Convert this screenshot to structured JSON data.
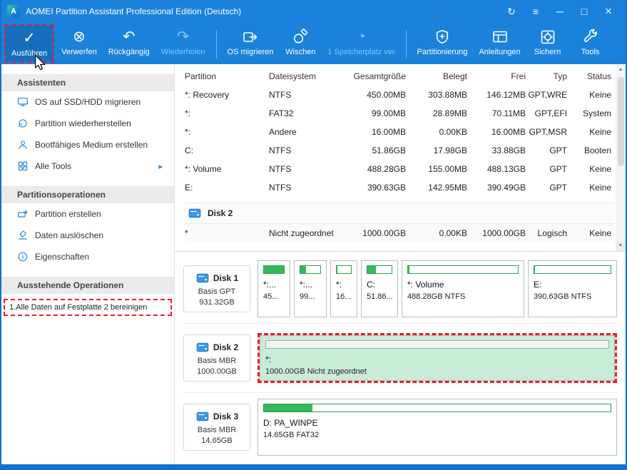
{
  "titlebar": {
    "title": "AOMEI Partition Assistant Professional Edition (Deutsch)",
    "logo_letter": "A",
    "controls": {
      "refresh": "↻",
      "menu": "≡",
      "minimize": "─",
      "maximize": "□",
      "close": "×"
    }
  },
  "toolbar": {
    "glyphs": {
      "check": "✓",
      "discard": "⊗",
      "undo": "↶",
      "redo": "↷",
      "space": "◔"
    },
    "buttons": [
      {
        "label": "Ausführen",
        "icon": "check-icon"
      },
      {
        "label": "Verwerfen",
        "icon": "discard-icon"
      },
      {
        "label": "Rückgängig",
        "icon": "undo-icon"
      },
      {
        "label": "Wiederholen",
        "icon": "redo-icon"
      },
      {
        "label": "OS migrieren",
        "icon": "migrate-icon"
      },
      {
        "label": "Wischen",
        "icon": "wipe-icon"
      },
      {
        "label": "1 Speicherplatz ver",
        "icon": "space-analyzer-icon"
      },
      {
        "label": "Partitionierung",
        "icon": "shield-plus-icon"
      },
      {
        "label": "Anleitungen",
        "icon": "guide-icon"
      },
      {
        "label": "Sichern",
        "icon": "safe-icon"
      },
      {
        "label": "Tools",
        "icon": "wrench-icon"
      }
    ]
  },
  "sidebar": {
    "chevron": "▸",
    "sections": [
      {
        "header": "Assistenten",
        "items": [
          {
            "label": "OS auf SSD/HDD migrieren",
            "icon": "monitor-icon"
          },
          {
            "label": "Partition wiederherstellen",
            "icon": "restore-icon"
          },
          {
            "label": "Bootfähiges Medium erstellen",
            "icon": "boot-medium-icon"
          },
          {
            "label": "Alle Tools",
            "icon": "grid-icon"
          }
        ]
      },
      {
        "header": "Partitionsoperationen",
        "items": [
          {
            "label": "Partition erstellen",
            "icon": "create-partition-icon"
          },
          {
            "label": "Daten auslöschen",
            "icon": "erase-icon"
          },
          {
            "label": "Eigenschaften",
            "icon": "info-icon"
          }
        ]
      },
      {
        "header": "Ausstehende Operationen",
        "items": [
          {
            "label": "1.Alle Daten auf Festplatte 2 bereinigen"
          }
        ]
      }
    ]
  },
  "table": {
    "columns": [
      "Partition",
      "Dateisystem",
      "Gesamtgröße",
      "Belegt",
      "Frei",
      "Typ",
      "Status"
    ],
    "rows": [
      {
        "partition": "*: Recovery",
        "fs": "NTFS",
        "total": "450.00MB",
        "used": "303.88MB",
        "free": "146.12MB",
        "typ": "GPT,WRE",
        "status": "Keine"
      },
      {
        "partition": "*:",
        "fs": "FAT32",
        "total": "99.00MB",
        "used": "28.89MB",
        "free": "70.11MB",
        "typ": "GPT,EFI",
        "status": "System"
      },
      {
        "partition": "*:",
        "fs": "Andere",
        "total": "16.00MB",
        "used": "0.00KB",
        "free": "16.00MB",
        "typ": "GPT,MSR",
        "status": "Keine"
      },
      {
        "partition": "C:",
        "fs": "NTFS",
        "total": "51.86GB",
        "used": "17.98GB",
        "free": "33.88GB",
        "typ": "GPT",
        "status": "Booten"
      },
      {
        "partition": "*: Volume",
        "fs": "NTFS",
        "total": "488.28GB",
        "used": "155.00MB",
        "free": "488.13GB",
        "typ": "GPT",
        "status": "Keine"
      },
      {
        "partition": "E:",
        "fs": "NTFS",
        "total": "390.63GB",
        "used": "142.95MB",
        "free": "390.49GB",
        "typ": "GPT",
        "status": "Keine"
      }
    ],
    "group_label": "Disk 2",
    "unallocated_row": {
      "partition": "*",
      "fs": "Nicht zugeordnet",
      "total": "1000.00GB",
      "used": "0.00KB",
      "free": "1000.00GB",
      "typ": "Logisch",
      "status": "Keine"
    },
    "scrollbar": {
      "up": "▲",
      "down": "▼"
    }
  },
  "disks": [
    {
      "name": "Disk 1",
      "type": "Basis GPT",
      "size": "931.32GB",
      "partitions": [
        {
          "line1": "*:...",
          "line2": "45..."
        },
        {
          "line1": "*:...",
          "line2": "99..."
        },
        {
          "line1": "*:",
          "line2": "16..."
        },
        {
          "line1": "C:",
          "line2": "51.86..."
        },
        {
          "line1": "*: Volume",
          "line2": "488.28GB NTFS"
        },
        {
          "line1": "E:",
          "line2": "390.63GB NTFS"
        }
      ]
    },
    {
      "name": "Disk 2",
      "type": "Basis MBR",
      "size": "1000.00GB",
      "partitions": [
        {
          "line1": "*:",
          "line2": "1000.00GB Nicht zugeordnet"
        }
      ]
    },
    {
      "name": "Disk 3",
      "type": "Basis MBR",
      "size": "14.65GB",
      "partitions": [
        {
          "line1": "D: PA_WINPE",
          "line2": "14.65GB FAT32"
        }
      ]
    }
  ],
  "colors": {
    "accent_blue": "#1a82db",
    "annotation_red": "#f2182b",
    "partition_green": "#35b858",
    "selected_mint": "#c9ecd8"
  }
}
